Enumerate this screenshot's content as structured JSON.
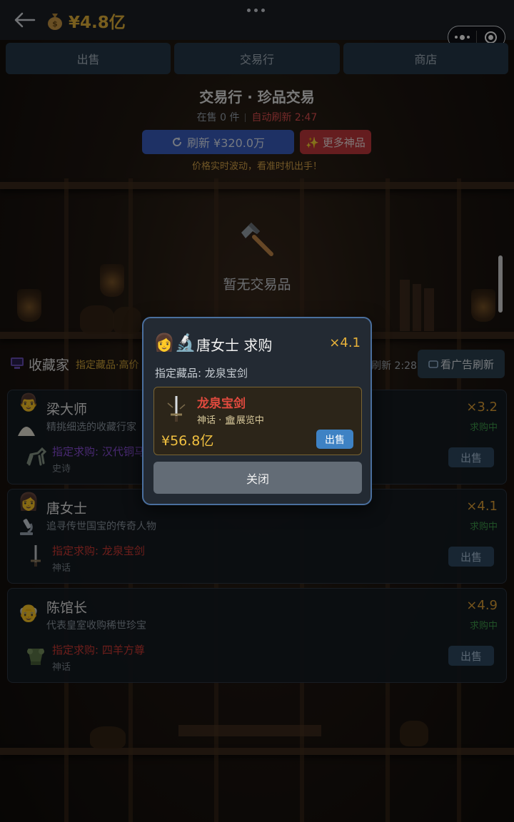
{
  "header": {
    "money": "¥4.8亿",
    "money_icon": "money-bag-icon"
  },
  "tabs": [
    {
      "label": "出售"
    },
    {
      "label": "交易行"
    },
    {
      "label": "商店"
    }
  ],
  "market": {
    "title": "交易行 · 珍品交易",
    "on_sale": "在售 0 件",
    "auto_refresh": "自动刷新 2:47",
    "refresh_button": "刷新 ¥320.0万",
    "more_button": "✨ 更多神品",
    "hint": "价格实时波动，看准时机出手！",
    "empty_text": "暂无交易品"
  },
  "collectors": {
    "title": "收藏家",
    "tag": "指定藏品·高价",
    "refresh_countdown": "刷新 2:28",
    "ad_button": "看广告刷新",
    "cards": [
      {
        "name": "梁大师",
        "avatar": "👨",
        "desc": "精挑细选的收藏行家",
        "multiplier": "×3.2",
        "status": "求购中",
        "request": "指定求购: 汉代铜马",
        "request_color": "#8a4fd8",
        "rarity": "史诗",
        "sell_label": "出售"
      },
      {
        "name": "唐女士",
        "avatar": "👩",
        "desc": "追寻传世国宝的传奇人物",
        "multiplier": "×4.1",
        "status": "求购中",
        "request": "指定求购: 龙泉宝剑",
        "request_color": "#d13b34",
        "rarity": "神话",
        "sell_label": "出售"
      },
      {
        "name": "陈馆长",
        "avatar": "👴",
        "desc": "代表皇室收购稀世珍宝",
        "multiplier": "×4.9",
        "status": "求购中",
        "request": "指定求购: 四羊方尊",
        "request_color": "#d13b34",
        "rarity": "神话",
        "sell_label": "出售"
      }
    ]
  },
  "modal": {
    "icons": "👩🔬",
    "title": "唐女士 求购",
    "multiplier": "×4.1",
    "target": "指定藏品: 龙泉宝剑",
    "item": {
      "name": "龙泉宝剑",
      "sub": "神话 · 🏛展览中",
      "price": "¥56.8亿",
      "sell_label": "出售"
    },
    "close_label": "关闭"
  }
}
